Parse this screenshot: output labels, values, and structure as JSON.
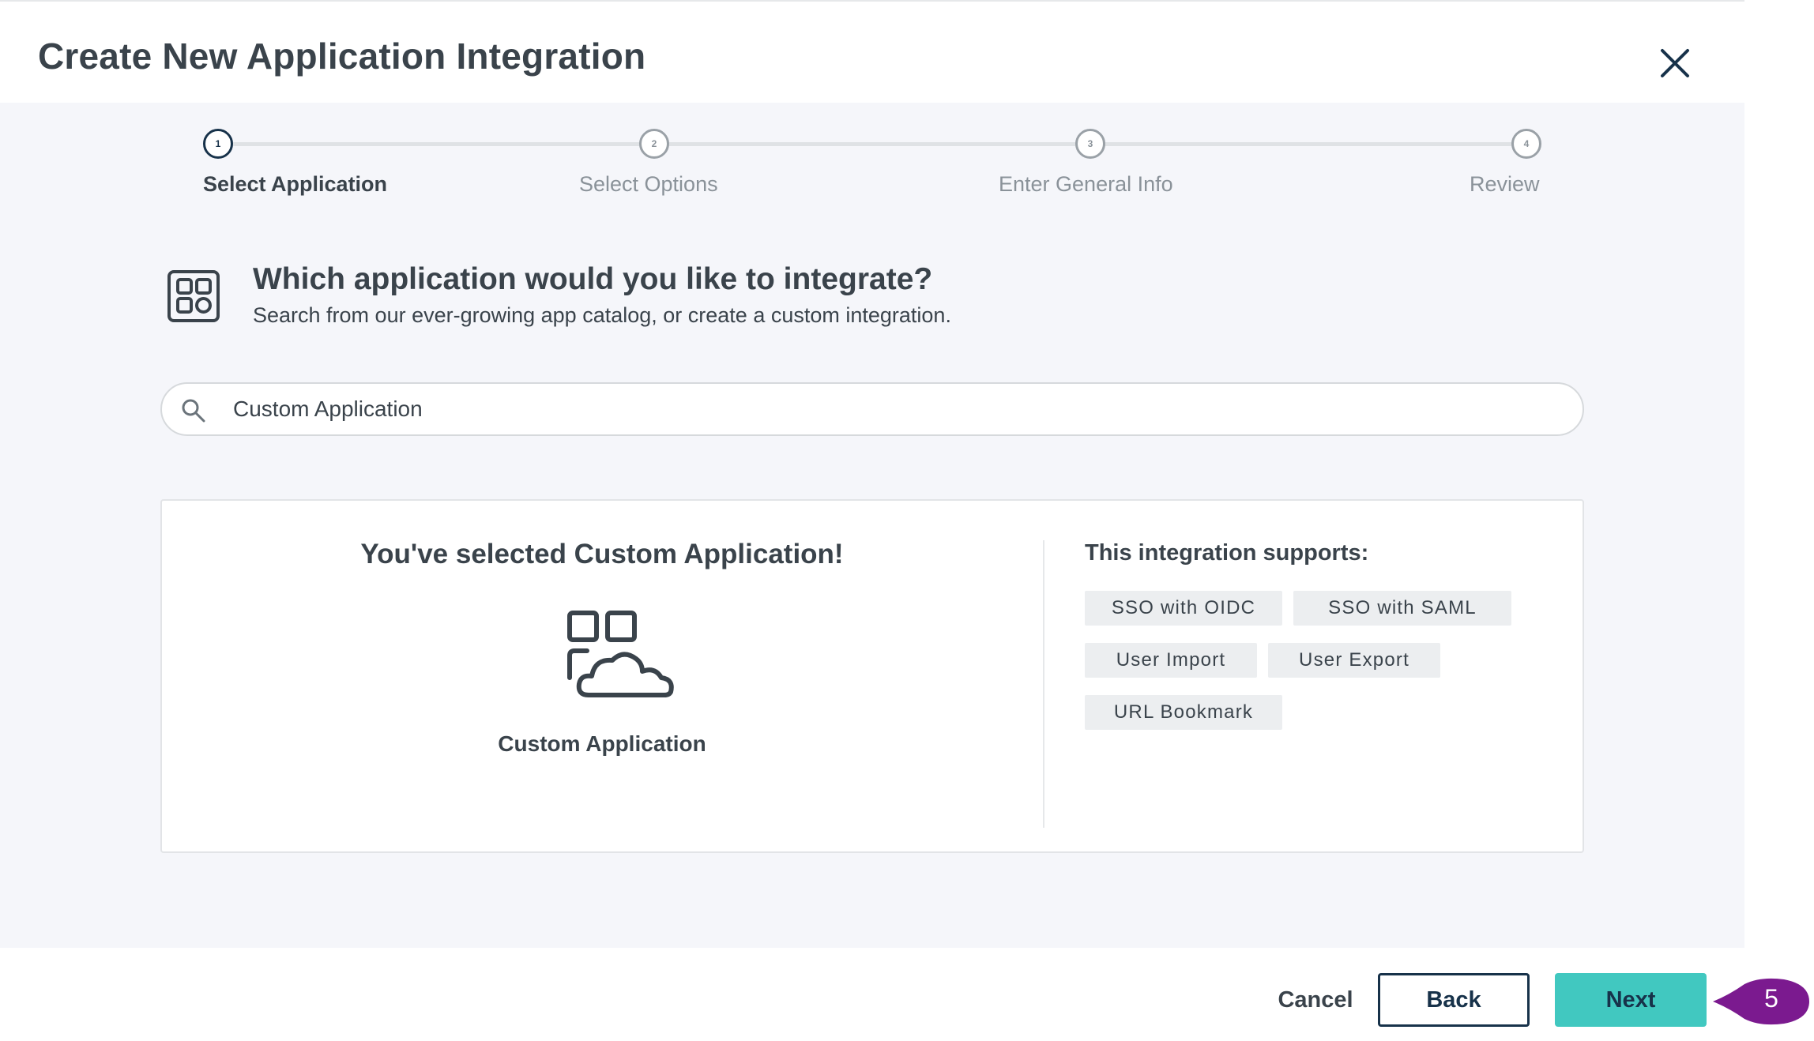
{
  "modal": {
    "title": "Create New Application Integration",
    "close_icon": "close-icon"
  },
  "stepper": {
    "steps": [
      {
        "number": "1",
        "label": "Select Application",
        "active": true
      },
      {
        "number": "2",
        "label": "Select Options",
        "active": false
      },
      {
        "number": "3",
        "label": "Enter General Info",
        "active": false
      },
      {
        "number": "4",
        "label": "Review",
        "active": false
      }
    ]
  },
  "question": {
    "icon": "app-grid-icon",
    "title": "Which application would you like to integrate?",
    "subtitle": "Search from our ever-growing app catalog, or create a custom integration."
  },
  "search": {
    "icon": "search-icon",
    "value": "Custom Application"
  },
  "selection": {
    "title": "You've selected Custom Application!",
    "app_icon": "custom-app-cloud-icon",
    "app_name": "Custom Application",
    "supports_title": "This integration supports:",
    "features": [
      "SSO with OIDC",
      "SSO with SAML",
      "User Import",
      "User Export",
      "URL Bookmark"
    ]
  },
  "footer": {
    "cancel_label": "Cancel",
    "back_label": "Back",
    "next_label": "Next"
  },
  "callout": {
    "number": "5",
    "color": "#7b1a8f"
  },
  "colors": {
    "accent": "#41c8c0",
    "dark": "#17324a",
    "text": "#3a434b",
    "background": "#f5f6fa"
  }
}
